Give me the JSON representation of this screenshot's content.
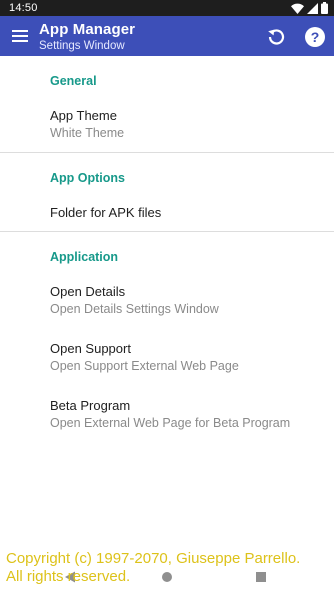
{
  "status_bar": {
    "time": "14:50",
    "icons": [
      "wifi-icon",
      "cellular-signal-icon",
      "battery-icon"
    ]
  },
  "app_bar": {
    "title": "App Manager",
    "subtitle": "Settings Window",
    "color": "#3d4fb8",
    "actions": [
      "refresh-icon",
      "help-icon"
    ]
  },
  "sections": [
    {
      "header": "General",
      "items": [
        {
          "title": "App Theme",
          "summary": "White Theme"
        }
      ]
    },
    {
      "header": "App Options",
      "items": [
        {
          "title": "Folder for APK files"
        }
      ]
    },
    {
      "header": "Application",
      "items": [
        {
          "title": "Open Details",
          "summary": "Open Details Settings Window"
        },
        {
          "title": "Open Support",
          "summary": "Open Support External Web Page"
        },
        {
          "title": "Beta Program",
          "summary": "Open External Web Page for Beta Program"
        }
      ]
    }
  ],
  "accent_color": "#17998a",
  "nav_bar": {
    "buttons": [
      "back-icon",
      "home-icon",
      "recents-icon"
    ]
  },
  "copyright": {
    "line1": "Copyright (c) 1997-2070, Giuseppe Parrello.",
    "line2": "All rights reserved."
  }
}
